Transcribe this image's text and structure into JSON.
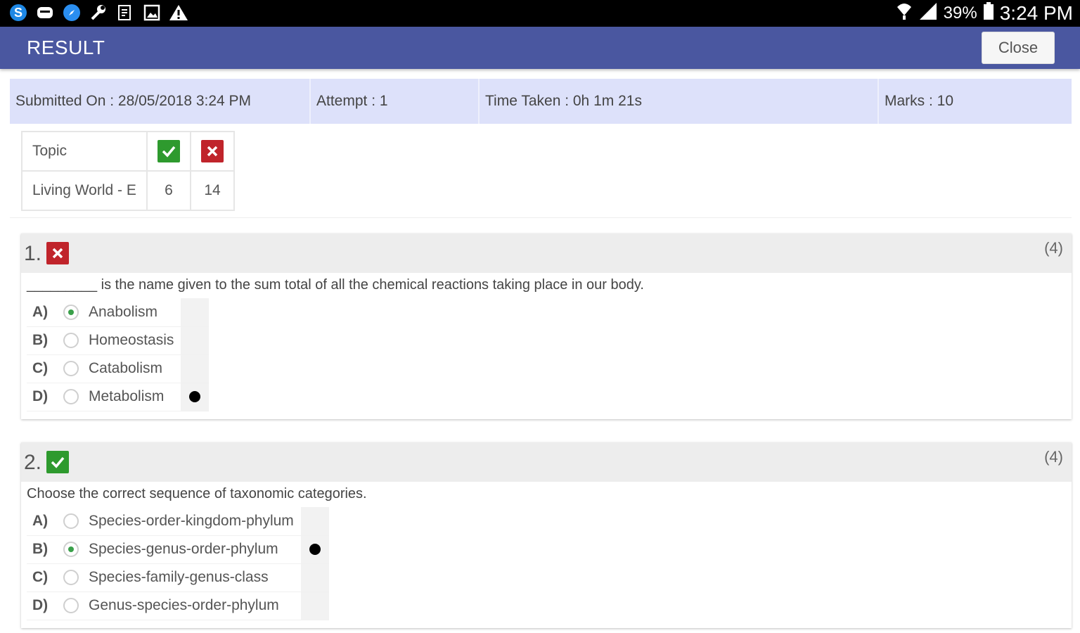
{
  "status_bar": {
    "icons": [
      "skype-icon",
      "chat-icon",
      "compass-icon",
      "wrench-icon",
      "document-icon",
      "image-icon",
      "warning-icon"
    ],
    "battery": "39%",
    "time": "3:24 PM"
  },
  "app_bar": {
    "title": "RESULT",
    "close_label": "Close"
  },
  "summary": {
    "submitted": "Submitted On : 28/05/2018 3:24 PM",
    "attempt": "Attempt : 1",
    "time_taken": "Time Taken : 0h 1m 21s",
    "marks": "Marks : 10"
  },
  "topic_table": {
    "header": "Topic",
    "row_name": "Living World - E",
    "correct": "6",
    "wrong": "14"
  },
  "questions": [
    {
      "number": "1.",
      "status": "wrong",
      "marks": "(4)",
      "text": "_________ is the name given to the sum total of all the chemical reactions taking place in our body.",
      "options": [
        {
          "letter": "A)",
          "text": "Anabolism",
          "selected": true,
          "correct": false
        },
        {
          "letter": "B)",
          "text": "Homeostasis",
          "selected": false,
          "correct": false
        },
        {
          "letter": "C)",
          "text": "Catabolism",
          "selected": false,
          "correct": false
        },
        {
          "letter": "D)",
          "text": "Metabolism",
          "selected": false,
          "correct": true
        }
      ]
    },
    {
      "number": "2.",
      "status": "correct",
      "marks": "(4)",
      "text": "Choose the correct sequence of taxonomic categories.",
      "options": [
        {
          "letter": "A)",
          "text": "Species-order-kingdom-phylum",
          "selected": false,
          "correct": false
        },
        {
          "letter": "B)",
          "text": "Species-genus-order-phylum",
          "selected": true,
          "correct": true
        },
        {
          "letter": "C)",
          "text": "Species-family-genus-class",
          "selected": false,
          "correct": false
        },
        {
          "letter": "D)",
          "text": "Genus-species-order-phylum",
          "selected": false,
          "correct": false
        }
      ]
    }
  ],
  "colors": {
    "app_bar": "#4a57a0",
    "summary_bg": "#dde1fa",
    "correct": "#2e9a2e",
    "wrong": "#c0242b"
  }
}
